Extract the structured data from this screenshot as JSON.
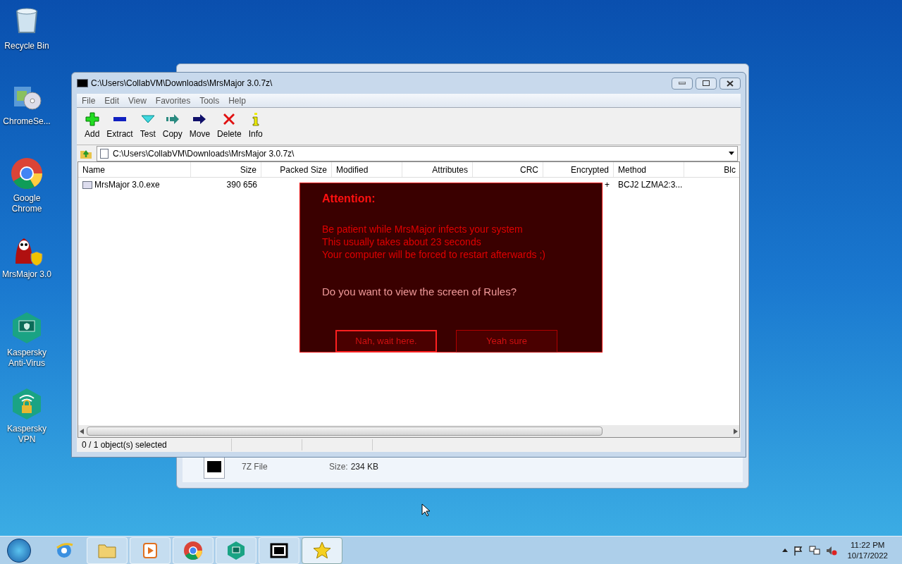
{
  "desktop_icons": [
    {
      "label": "Recycle Bin",
      "kind": "recycle"
    },
    {
      "label": "ChromeSe...",
      "kind": "installer"
    },
    {
      "label": "Google Chrome",
      "kind": "chrome"
    },
    {
      "label": "MrsMajor 3.0",
      "kind": "mrsmajor"
    },
    {
      "label": "Kaspersky Anti-Virus",
      "kind": "kaspersky"
    },
    {
      "label": "Kaspersky VPN",
      "kind": "vpn"
    }
  ],
  "back_window": {
    "file_type": "7Z File",
    "size_label": "Size:",
    "size_value": "234 KB"
  },
  "window": {
    "title": "C:\\Users\\CollabVM\\Downloads\\MrsMajor 3.0.7z\\",
    "menu": [
      "File",
      "Edit",
      "View",
      "Favorites",
      "Tools",
      "Help"
    ],
    "toolbar": [
      {
        "label": "Add",
        "kind": "add"
      },
      {
        "label": "Extract",
        "kind": "extract"
      },
      {
        "label": "Test",
        "kind": "test"
      },
      {
        "label": "Copy",
        "kind": "copy"
      },
      {
        "label": "Move",
        "kind": "move"
      },
      {
        "label": "Delete",
        "kind": "delete"
      },
      {
        "label": "Info",
        "kind": "info"
      }
    ],
    "address": "C:\\Users\\CollabVM\\Downloads\\MrsMajor 3.0.7z\\",
    "columns": [
      "Name",
      "Size",
      "Packed Size",
      "Modified",
      "Attributes",
      "CRC",
      "Encrypted",
      "Method",
      "Blc"
    ],
    "rows": [
      {
        "name": "MrsMajor 3.0.exe",
        "size": "390 656",
        "encrypted": "+",
        "method": "BCJ2 LZMA2:3..."
      }
    ],
    "status_bar": [
      "0 / 1 object(s) selected"
    ]
  },
  "dialog": {
    "title": "Attention:",
    "lines": [
      "Be patient while MrsMajor infects your system",
      "This usually takes about 23 seconds",
      "Your computer will be forced to restart afterwards ;)"
    ],
    "question": "Do you want to view the screen of Rules?",
    "buttons": [
      {
        "label": "Nah, wait here.",
        "selected": true
      },
      {
        "label": "Yeah sure",
        "selected": false
      }
    ]
  },
  "taskbar": {
    "apps": [
      {
        "kind": "ie",
        "active": false
      },
      {
        "kind": "explorer",
        "active": false
      },
      {
        "kind": "media",
        "active": false
      },
      {
        "kind": "chrome",
        "active": false
      },
      {
        "kind": "kaspersky",
        "active": false
      },
      {
        "kind": "sevenzip",
        "active": false
      },
      {
        "kind": "star",
        "active": true
      }
    ],
    "time": "11:22 PM",
    "date": "10/17/2022"
  }
}
